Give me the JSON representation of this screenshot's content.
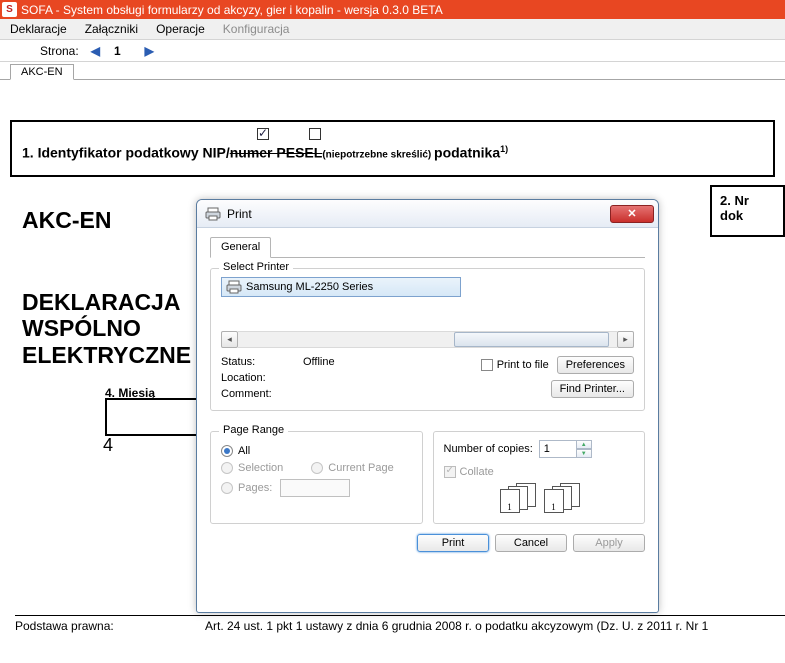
{
  "titlebar": "SOFA - System obsługi formularzy od akcyzy, gier i kopalin - wersja 0.3.0 BETA",
  "menu": {
    "decl": "Deklaracje",
    "att": "Załączniki",
    "ops": "Operacje",
    "cfg": "Konfiguracja"
  },
  "pagenav": {
    "label": "Strona:",
    "page": "1"
  },
  "filetab": "AKC-EN",
  "line1": {
    "num": "1. ",
    "a": "Identyfikator podatkowy NIP/",
    "b": "numer PESEL",
    "c": "(niepotrzebne skreślić) ",
    "d": "podatnika",
    "sup": "1)"
  },
  "nrbox": "2. Nr dok",
  "title1": "AKC-EN",
  "title2a": "DEKLARACJA ",
  "title2b": " WSPÓLNO",
  "title2c": "ELEKTRYCZNE",
  "box4": {
    "label": "4. Miesią",
    "val": "4"
  },
  "legal": {
    "label": "Podstawa prawna:",
    "text": "Art. 24 ust. 1 pkt 1  ustawy z dnia 6 grudnia 2008 r. o podatku akcyzowym (Dz. U. z 2011 r. Nr 1"
  },
  "print": {
    "title": "Print",
    "tab": "General",
    "selectPrinter": "Select Printer",
    "printer": "Samsung ML-2250 Series",
    "status_lbl": "Status:",
    "status_val": "Offline",
    "location_lbl": "Location:",
    "comment_lbl": "Comment:",
    "printToFile": "Print to file",
    "prefs": "Preferences",
    "find": "Find Printer...",
    "pr_title": "Page Range",
    "all": "All",
    "selection": "Selection",
    "currentPage": "Current Page",
    "pages": "Pages:",
    "copies_lbl": "Number of copies:",
    "copies_val": "1",
    "collate": "Collate",
    "printBtn": "Print",
    "cancel": "Cancel",
    "apply": "Apply"
  }
}
